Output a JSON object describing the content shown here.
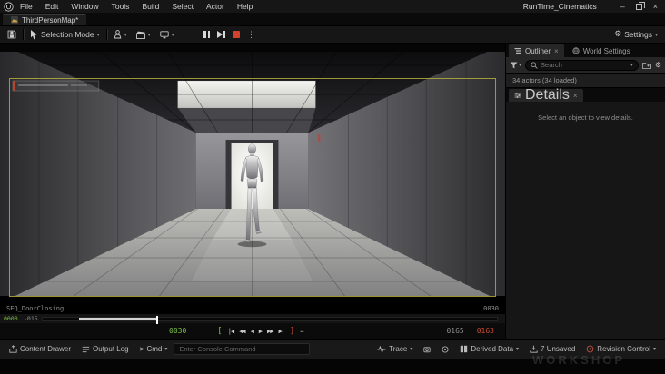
{
  "menubar": {
    "menus": [
      "File",
      "Edit",
      "Window",
      "Tools",
      "Build",
      "Select",
      "Actor",
      "Help"
    ],
    "project_title": "RunTime_Cinematics"
  },
  "tabbar": {
    "level_tab": "ThirdPersonMap*"
  },
  "toolbar": {
    "selection_mode_label": "Selection Mode",
    "settings_label": "Settings"
  },
  "viewport": {
    "sequence_name": "SEQ_DoorClosing",
    "frame_counter": "0030"
  },
  "sequencer": {
    "range_start": "0000",
    "range_offset": "-015",
    "current_frame": "0030",
    "playback_end": "0165",
    "working_end": "0163",
    "bracket_open": "[",
    "bracket_close": "]",
    "transport": [
      "|◀",
      "◀◀",
      "◀",
      "▶",
      "▶▶",
      "▶|"
    ],
    "jump_arrow": "→"
  },
  "outliner": {
    "tab_label": "Outliner",
    "world_settings_label": "World Settings",
    "search_placeholder": "Search",
    "actor_count": "34 actors (34 loaded)"
  },
  "details": {
    "tab_label": "Details",
    "empty_message": "Select an object to view details."
  },
  "statusbar": {
    "content_drawer": "Content Drawer",
    "output_log": "Output Log",
    "cmd_label": "Cmd",
    "console_placeholder": "Enter Console Command",
    "trace_label": "Trace",
    "derived_data_label": "Derived Data",
    "unsaved_label": "7 Unsaved",
    "revision_control_label": "Revision Control"
  },
  "glyphs": {
    "chevron_down": "▾",
    "close": "×",
    "ellipsis": "⋮",
    "minimize": "–",
    "cmd_prompt": ">",
    "gear": "⚙"
  },
  "watermark": {
    "text": "WORKSHOP"
  },
  "colors": {
    "accent_green": "#7ec24a",
    "accent_red": "#d14b32",
    "safe_frame_yellow": "#b5ae39",
    "stop_button_red": "#d1422e"
  }
}
